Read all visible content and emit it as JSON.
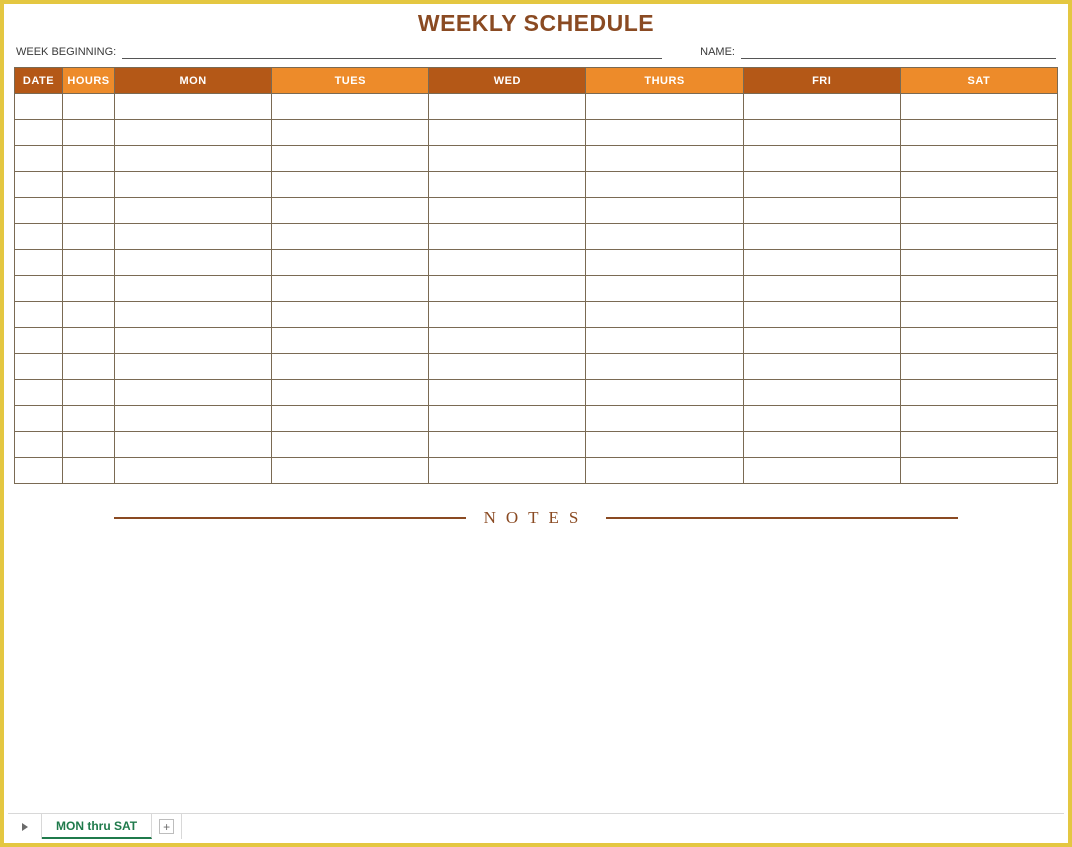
{
  "title": "WEEKLY SCHEDULE",
  "meta": {
    "week_beginning_label": "WEEK BEGINNING:",
    "week_beginning_value": "",
    "name_label": "NAME:",
    "name_value": ""
  },
  "headers": {
    "date": "DATE",
    "hours": "HOURS",
    "days": [
      "MON",
      "TUES",
      "WED",
      "THURS",
      "FRI",
      "SAT"
    ]
  },
  "rows": [
    {
      "date": "",
      "hours": "",
      "mon": "",
      "tues": "",
      "wed": "",
      "thurs": "",
      "fri": "",
      "sat": ""
    },
    {
      "date": "",
      "hours": "",
      "mon": "",
      "tues": "",
      "wed": "",
      "thurs": "",
      "fri": "",
      "sat": ""
    },
    {
      "date": "",
      "hours": "",
      "mon": "",
      "tues": "",
      "wed": "",
      "thurs": "",
      "fri": "",
      "sat": ""
    },
    {
      "date": "",
      "hours": "",
      "mon": "",
      "tues": "",
      "wed": "",
      "thurs": "",
      "fri": "",
      "sat": ""
    },
    {
      "date": "",
      "hours": "",
      "mon": "",
      "tues": "",
      "wed": "",
      "thurs": "",
      "fri": "",
      "sat": ""
    },
    {
      "date": "",
      "hours": "",
      "mon": "",
      "tues": "",
      "wed": "",
      "thurs": "",
      "fri": "",
      "sat": ""
    },
    {
      "date": "",
      "hours": "",
      "mon": "",
      "tues": "",
      "wed": "",
      "thurs": "",
      "fri": "",
      "sat": ""
    },
    {
      "date": "",
      "hours": "",
      "mon": "",
      "tues": "",
      "wed": "",
      "thurs": "",
      "fri": "",
      "sat": ""
    },
    {
      "date": "",
      "hours": "",
      "mon": "",
      "tues": "",
      "wed": "",
      "thurs": "",
      "fri": "",
      "sat": ""
    },
    {
      "date": "",
      "hours": "",
      "mon": "",
      "tues": "",
      "wed": "",
      "thurs": "",
      "fri": "",
      "sat": ""
    },
    {
      "date": "",
      "hours": "",
      "mon": "",
      "tues": "",
      "wed": "",
      "thurs": "",
      "fri": "",
      "sat": ""
    },
    {
      "date": "",
      "hours": "",
      "mon": "",
      "tues": "",
      "wed": "",
      "thurs": "",
      "fri": "",
      "sat": ""
    },
    {
      "date": "",
      "hours": "",
      "mon": "",
      "tues": "",
      "wed": "",
      "thurs": "",
      "fri": "",
      "sat": ""
    },
    {
      "date": "",
      "hours": "",
      "mon": "",
      "tues": "",
      "wed": "",
      "thurs": "",
      "fri": "",
      "sat": ""
    },
    {
      "date": "",
      "hours": "",
      "mon": "",
      "tues": "",
      "wed": "",
      "thurs": "",
      "fri": "",
      "sat": ""
    }
  ],
  "notes_label": "NOTES",
  "sheet_tabs": {
    "active": "MON thru SAT"
  }
}
